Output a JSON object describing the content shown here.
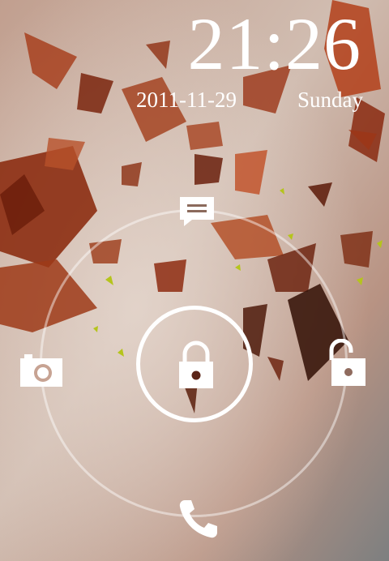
{
  "lockscreen": {
    "time": "21:26",
    "date": "2011-11-29",
    "weekday": "Sunday"
  },
  "targets": {
    "top": "message-icon",
    "left": "camera-icon",
    "right": "unlock-icon",
    "bottom": "phone-icon",
    "center": "lock-icon"
  },
  "colors": {
    "text": "#ffffff",
    "ring": "#ffffff",
    "shard_dark": "#8a2a10",
    "shard_mid": "#b4461e",
    "shard_light": "#c8582a",
    "accent_green": "#b5c41c"
  }
}
